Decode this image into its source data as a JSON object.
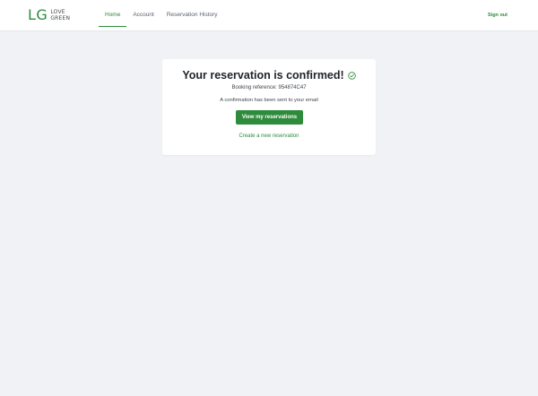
{
  "header": {
    "logo": {
      "mark": "LG",
      "line1": "LOVE",
      "line2": "GREEN"
    },
    "nav": [
      {
        "label": "Home",
        "active": true
      },
      {
        "label": "Account",
        "active": false
      },
      {
        "label": "Reservation History",
        "active": false
      }
    ],
    "sign_out_label": "Sign out"
  },
  "confirmation": {
    "title": "Your reservation is confirmed!",
    "booking_reference": "Booking reference: 954874C47",
    "email_note": "A confirmation has been sent to your email",
    "primary_button_label": "View my reservations",
    "secondary_link_label": "Create a new reservation",
    "status_icon": "check-circle-icon"
  },
  "colors": {
    "brand": "#2e8b3c",
    "background": "#f1f2f6",
    "card": "#ffffff"
  }
}
